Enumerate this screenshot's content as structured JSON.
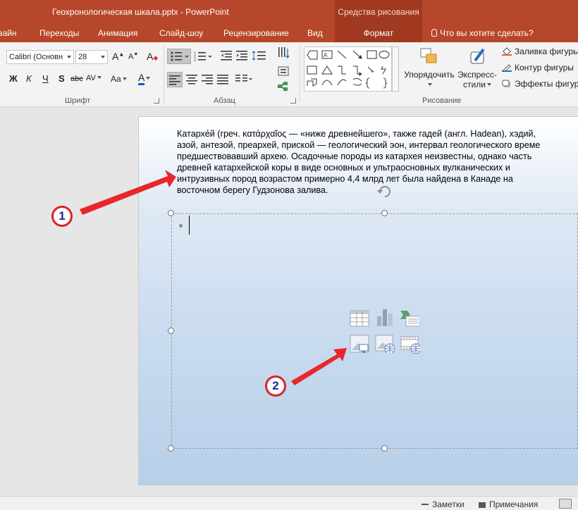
{
  "window": {
    "title": "Геохронологическая шкала.pptx - PowerPoint",
    "contextual_group": "Средства рисования"
  },
  "tabs": [
    {
      "label": "зайн"
    },
    {
      "label": "Переходы"
    },
    {
      "label": "Анимация"
    },
    {
      "label": "Слайд-шоу"
    },
    {
      "label": "Рецензирование"
    },
    {
      "label": "Вид"
    }
  ],
  "active_tab": "Формат",
  "tell_me": "Что вы хотите сделать?",
  "ribbon": {
    "font_group": {
      "label": "Шрифт",
      "font_name": "Calibri (Основн",
      "font_size": "28",
      "grow": "A",
      "shrink": "A",
      "clear": "A",
      "bold": "Ж",
      "italic": "К",
      "underline": "Ч",
      "shadow": "S",
      "strike": "abc",
      "spacing": "AV",
      "case": "Aa",
      "color": "A"
    },
    "paragraph_group": {
      "label": "Абзац"
    },
    "drawing_group": {
      "label": "Рисование",
      "arrange": "Упорядочить",
      "quick_styles_line1": "Экспресс-",
      "quick_styles_line2": "стили",
      "fill": "Заливка фигуры",
      "outline": "Контур фигуры",
      "effects": "Эффекты фигур"
    }
  },
  "slide": {
    "text_lines": [
      "Катархе́й (греч. κατάρχαῖος — «ниже древнейшего», также гадей (англ. Hadean), хэдий,",
      "азой, антезой, преархей, приской — геологический эон, интервал геологического време",
      "предшествовавший архею. Осадочные породы из катархея неизвестны, однако часть",
      "древней катархейской коры в виде основных и ультраосновных вулканических и",
      "интрузивных пород возрастом примерно 4,4 млрд лет была найдена в Канаде на",
      "восточном берегу Гудзонова залива."
    ]
  },
  "annotations": {
    "marker1": "1",
    "marker2": "2"
  },
  "statusbar": {
    "notes": "Заметки",
    "comments": "Примечания"
  },
  "colors": {
    "accent": "#b7472a",
    "accent_dark": "#a0391f",
    "arrow": "#e8262c"
  }
}
